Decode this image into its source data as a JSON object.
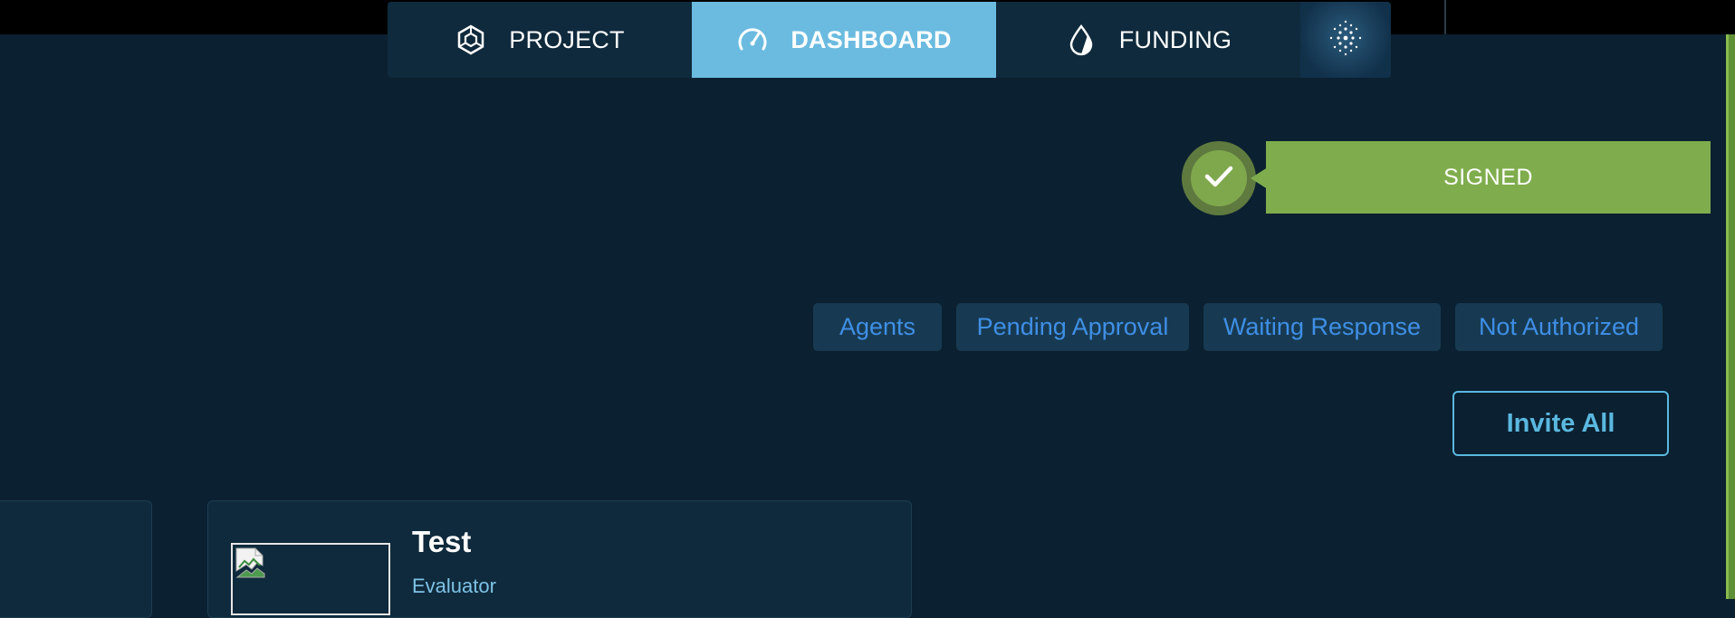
{
  "nav": {
    "items": [
      {
        "label": "PROJECT",
        "icon": "project-hex-icon",
        "active": false
      },
      {
        "label": "DASHBOARD",
        "icon": "speedometer-icon",
        "active": true
      },
      {
        "label": "FUNDING",
        "icon": "drop-icon",
        "active": false
      }
    ],
    "extra_icon": "dot-grid-icon"
  },
  "status": {
    "label": "SIGNED",
    "icon": "check-icon",
    "color": "#7fad4d"
  },
  "filters": [
    "Agents",
    "Pending Approval",
    "Waiting Response",
    "Not Authorized"
  ],
  "invite_label": "Invite All",
  "card": {
    "name": "Test",
    "role": "Evaluator",
    "image_icon": "broken-image-icon"
  },
  "colors": {
    "background": "#0b2030",
    "nav_active": "#6bbbe0",
    "filter_text": "#3f8fe6",
    "invite_border": "#5ab8e0",
    "accent_green": "#7fad4d"
  }
}
